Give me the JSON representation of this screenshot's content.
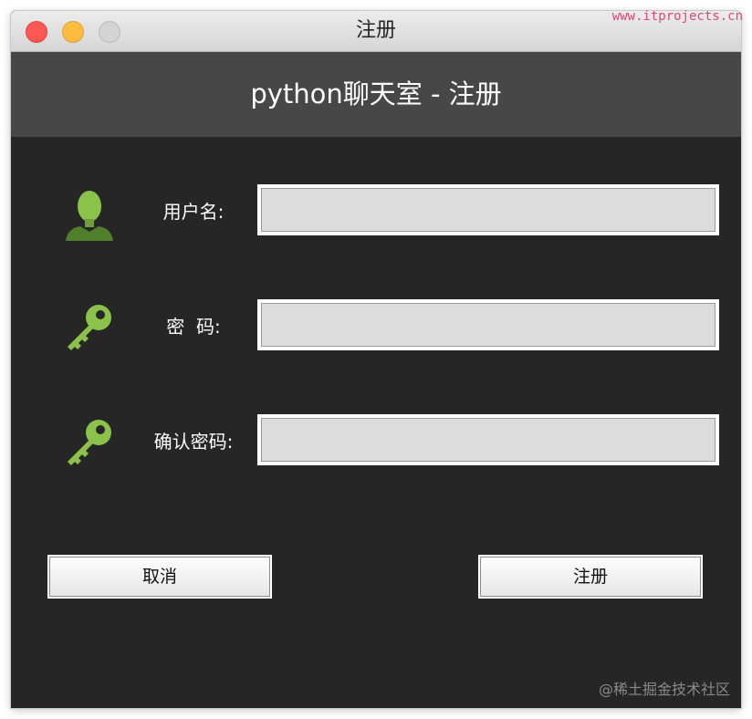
{
  "window": {
    "title": "注册"
  },
  "header": {
    "title": "python聊天室 - 注册"
  },
  "form": {
    "username_label": "用户名:",
    "password_label": "密  码:",
    "confirm_label": "确认密码:",
    "username_value": "",
    "password_value": "",
    "confirm_value": ""
  },
  "buttons": {
    "cancel_label": "取消",
    "register_label": "注册"
  },
  "watermarks": {
    "site": "www.itprojects.cn",
    "community": "@稀土掘金技术社区"
  },
  "colors": {
    "window_bg": "#262626",
    "header_bg": "#474747",
    "icon_green": "#8bc34a",
    "watermark_pink": "#e0457b"
  }
}
